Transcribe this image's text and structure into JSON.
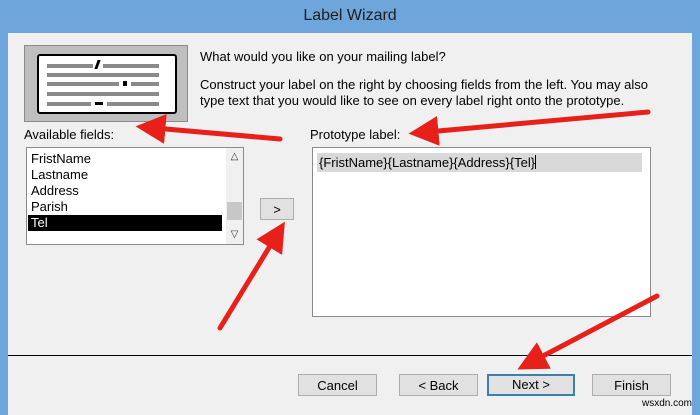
{
  "window": {
    "title": "Label Wizard"
  },
  "intro": {
    "question": "What would you like on your mailing label?",
    "instructions_line1": "Construct your label on the right by choosing fields from the left. You may also",
    "instructions_line2": "type text that you would like to see on every label right onto the prototype."
  },
  "available_fields": {
    "label": "Available fields:",
    "items": [
      "FristName",
      "Lastname",
      "Address",
      "Parish",
      "Tel"
    ],
    "selected": "Tel"
  },
  "add_button": {
    "label": ">"
  },
  "prototype": {
    "label": "Prototype label:",
    "text": "{FristName}{Lastname}{Address}{Tel}"
  },
  "footer": {
    "cancel": "Cancel",
    "back": "< Back",
    "next": "Next >",
    "finish": "Finish"
  },
  "annotations": {
    "arrow_color": "#e8201a"
  },
  "watermark": "wsxdn.com"
}
